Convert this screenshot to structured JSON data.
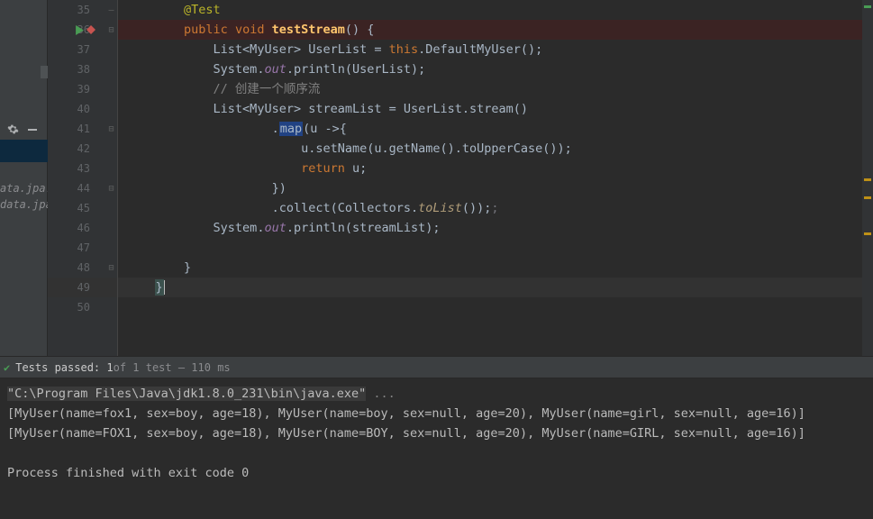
{
  "sidebar": {
    "txt1": "ata.jpa.do",
    "txt2": "data.jpa.o"
  },
  "gutter": {
    "lines": [
      "35",
      "36",
      "37",
      "38",
      "39",
      "40",
      "41",
      "42",
      "43",
      "44",
      "45",
      "46",
      "47",
      "48",
      "49",
      "50"
    ]
  },
  "code": {
    "l35_ann": "@Test",
    "l36_kw1": "public",
    "l36_kw2": "void",
    "l36_name": "testStream",
    "l36_rest": "() {",
    "l37_a": "List<MyUser> UserList = ",
    "l37_kw": "this",
    "l37_b": ".DefaultMyUser();",
    "l38_a": "System.",
    "l38_out": "out",
    "l38_b": ".println(UserList);",
    "l39_cmt": "// 创建一个顺序流",
    "l40": "List<MyUser> streamList = UserList.stream()",
    "l41_a": ".",
    "l41_map": "map",
    "l41_b": "(u ->{",
    "l42": "u.setName(u.getName().toUpperCase());",
    "l43_kw": "return",
    "l43_b": " u;",
    "l44": "})",
    "l45_a": ".collect(Collectors.",
    "l45_m": "toList",
    "l45_b": "());",
    "l45_c": ";",
    "l46_a": "System.",
    "l46_out": "out",
    "l46_b": ".println(streamList);",
    "l48": "}",
    "l49": "}"
  },
  "testbar": {
    "passed": "Tests passed: 1",
    "rest": " of 1 test – 110 ms"
  },
  "console": {
    "l1_a": "\"C:\\Program Files\\Java\\jdk1.8.0_231\\bin\\java.exe\"",
    "l1_b": " ...",
    "l2": "[MyUser(name=fox1, sex=boy, age=18), MyUser(name=boy, sex=null, age=20), MyUser(name=girl, sex=null, age=16)]",
    "l3": "[MyUser(name=FOX1, sex=boy, age=18), MyUser(name=BOY, sex=null, age=20), MyUser(name=GIRL, sex=null, age=16)]",
    "l4": "",
    "l5": "Process finished with exit code 0"
  }
}
